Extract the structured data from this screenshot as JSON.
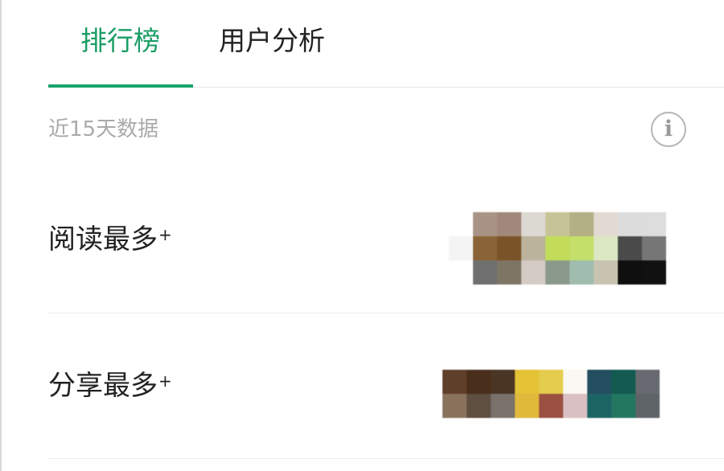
{
  "tabs": [
    {
      "label": "排行榜",
      "active": true
    },
    {
      "label": "用户分析",
      "active": false
    }
  ],
  "accent_color": "#1a9d64",
  "subtitle": "近15天数据",
  "info_icon": "info-circle-icon",
  "rankings": [
    {
      "label": "阅读最多",
      "suffix": "+"
    },
    {
      "label": "分享最多",
      "suffix": "+"
    }
  ]
}
